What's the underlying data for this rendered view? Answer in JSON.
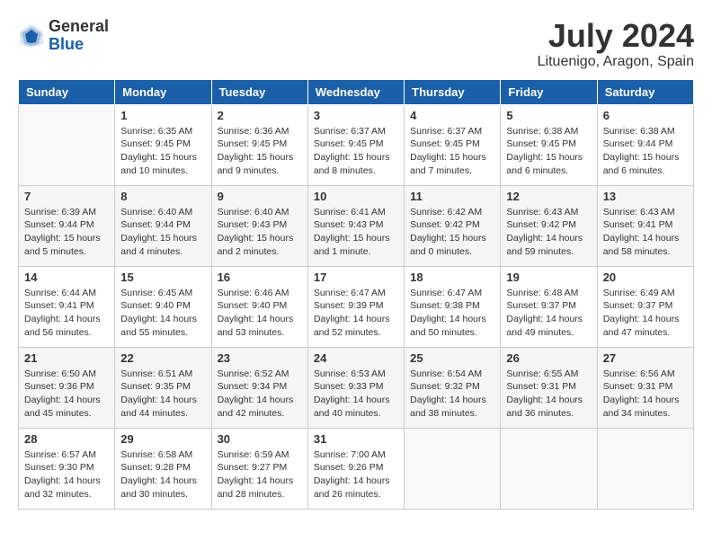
{
  "logo": {
    "general": "General",
    "blue": "Blue"
  },
  "header": {
    "month_year": "July 2024",
    "location": "Lituenigo, Aragon, Spain"
  },
  "days_of_week": [
    "Sunday",
    "Monday",
    "Tuesday",
    "Wednesday",
    "Thursday",
    "Friday",
    "Saturday"
  ],
  "weeks": [
    [
      {
        "day": "",
        "empty": true
      },
      {
        "day": "1",
        "sunrise": "Sunrise: 6:35 AM",
        "sunset": "Sunset: 9:45 PM",
        "daylight": "Daylight: 15 hours and 10 minutes."
      },
      {
        "day": "2",
        "sunrise": "Sunrise: 6:36 AM",
        "sunset": "Sunset: 9:45 PM",
        "daylight": "Daylight: 15 hours and 9 minutes."
      },
      {
        "day": "3",
        "sunrise": "Sunrise: 6:37 AM",
        "sunset": "Sunset: 9:45 PM",
        "daylight": "Daylight: 15 hours and 8 minutes."
      },
      {
        "day": "4",
        "sunrise": "Sunrise: 6:37 AM",
        "sunset": "Sunset: 9:45 PM",
        "daylight": "Daylight: 15 hours and 7 minutes."
      },
      {
        "day": "5",
        "sunrise": "Sunrise: 6:38 AM",
        "sunset": "Sunset: 9:45 PM",
        "daylight": "Daylight: 15 hours and 6 minutes."
      },
      {
        "day": "6",
        "sunrise": "Sunrise: 6:38 AM",
        "sunset": "Sunset: 9:44 PM",
        "daylight": "Daylight: 15 hours and 6 minutes."
      }
    ],
    [
      {
        "day": "7",
        "sunrise": "Sunrise: 6:39 AM",
        "sunset": "Sunset: 9:44 PM",
        "daylight": "Daylight: 15 hours and 5 minutes."
      },
      {
        "day": "8",
        "sunrise": "Sunrise: 6:40 AM",
        "sunset": "Sunset: 9:44 PM",
        "daylight": "Daylight: 15 hours and 4 minutes."
      },
      {
        "day": "9",
        "sunrise": "Sunrise: 6:40 AM",
        "sunset": "Sunset: 9:43 PM",
        "daylight": "Daylight: 15 hours and 2 minutes."
      },
      {
        "day": "10",
        "sunrise": "Sunrise: 6:41 AM",
        "sunset": "Sunset: 9:43 PM",
        "daylight": "Daylight: 15 hours and 1 minute."
      },
      {
        "day": "11",
        "sunrise": "Sunrise: 6:42 AM",
        "sunset": "Sunset: 9:42 PM",
        "daylight": "Daylight: 15 hours and 0 minutes."
      },
      {
        "day": "12",
        "sunrise": "Sunrise: 6:43 AM",
        "sunset": "Sunset: 9:42 PM",
        "daylight": "Daylight: 14 hours and 59 minutes."
      },
      {
        "day": "13",
        "sunrise": "Sunrise: 6:43 AM",
        "sunset": "Sunset: 9:41 PM",
        "daylight": "Daylight: 14 hours and 58 minutes."
      }
    ],
    [
      {
        "day": "14",
        "sunrise": "Sunrise: 6:44 AM",
        "sunset": "Sunset: 9:41 PM",
        "daylight": "Daylight: 14 hours and 56 minutes."
      },
      {
        "day": "15",
        "sunrise": "Sunrise: 6:45 AM",
        "sunset": "Sunset: 9:40 PM",
        "daylight": "Daylight: 14 hours and 55 minutes."
      },
      {
        "day": "16",
        "sunrise": "Sunrise: 6:46 AM",
        "sunset": "Sunset: 9:40 PM",
        "daylight": "Daylight: 14 hours and 53 minutes."
      },
      {
        "day": "17",
        "sunrise": "Sunrise: 6:47 AM",
        "sunset": "Sunset: 9:39 PM",
        "daylight": "Daylight: 14 hours and 52 minutes."
      },
      {
        "day": "18",
        "sunrise": "Sunrise: 6:47 AM",
        "sunset": "Sunset: 9:38 PM",
        "daylight": "Daylight: 14 hours and 50 minutes."
      },
      {
        "day": "19",
        "sunrise": "Sunrise: 6:48 AM",
        "sunset": "Sunset: 9:37 PM",
        "daylight": "Daylight: 14 hours and 49 minutes."
      },
      {
        "day": "20",
        "sunrise": "Sunrise: 6:49 AM",
        "sunset": "Sunset: 9:37 PM",
        "daylight": "Daylight: 14 hours and 47 minutes."
      }
    ],
    [
      {
        "day": "21",
        "sunrise": "Sunrise: 6:50 AM",
        "sunset": "Sunset: 9:36 PM",
        "daylight": "Daylight: 14 hours and 45 minutes."
      },
      {
        "day": "22",
        "sunrise": "Sunrise: 6:51 AM",
        "sunset": "Sunset: 9:35 PM",
        "daylight": "Daylight: 14 hours and 44 minutes."
      },
      {
        "day": "23",
        "sunrise": "Sunrise: 6:52 AM",
        "sunset": "Sunset: 9:34 PM",
        "daylight": "Daylight: 14 hours and 42 minutes."
      },
      {
        "day": "24",
        "sunrise": "Sunrise: 6:53 AM",
        "sunset": "Sunset: 9:33 PM",
        "daylight": "Daylight: 14 hours and 40 minutes."
      },
      {
        "day": "25",
        "sunrise": "Sunrise: 6:54 AM",
        "sunset": "Sunset: 9:32 PM",
        "daylight": "Daylight: 14 hours and 38 minutes."
      },
      {
        "day": "26",
        "sunrise": "Sunrise: 6:55 AM",
        "sunset": "Sunset: 9:31 PM",
        "daylight": "Daylight: 14 hours and 36 minutes."
      },
      {
        "day": "27",
        "sunrise": "Sunrise: 6:56 AM",
        "sunset": "Sunset: 9:31 PM",
        "daylight": "Daylight: 14 hours and 34 minutes."
      }
    ],
    [
      {
        "day": "28",
        "sunrise": "Sunrise: 6:57 AM",
        "sunset": "Sunset: 9:30 PM",
        "daylight": "Daylight: 14 hours and 32 minutes."
      },
      {
        "day": "29",
        "sunrise": "Sunrise: 6:58 AM",
        "sunset": "Sunset: 9:28 PM",
        "daylight": "Daylight: 14 hours and 30 minutes."
      },
      {
        "day": "30",
        "sunrise": "Sunrise: 6:59 AM",
        "sunset": "Sunset: 9:27 PM",
        "daylight": "Daylight: 14 hours and 28 minutes."
      },
      {
        "day": "31",
        "sunrise": "Sunrise: 7:00 AM",
        "sunset": "Sunset: 9:26 PM",
        "daylight": "Daylight: 14 hours and 26 minutes."
      },
      {
        "day": "",
        "empty": true
      },
      {
        "day": "",
        "empty": true
      },
      {
        "day": "",
        "empty": true
      }
    ]
  ]
}
